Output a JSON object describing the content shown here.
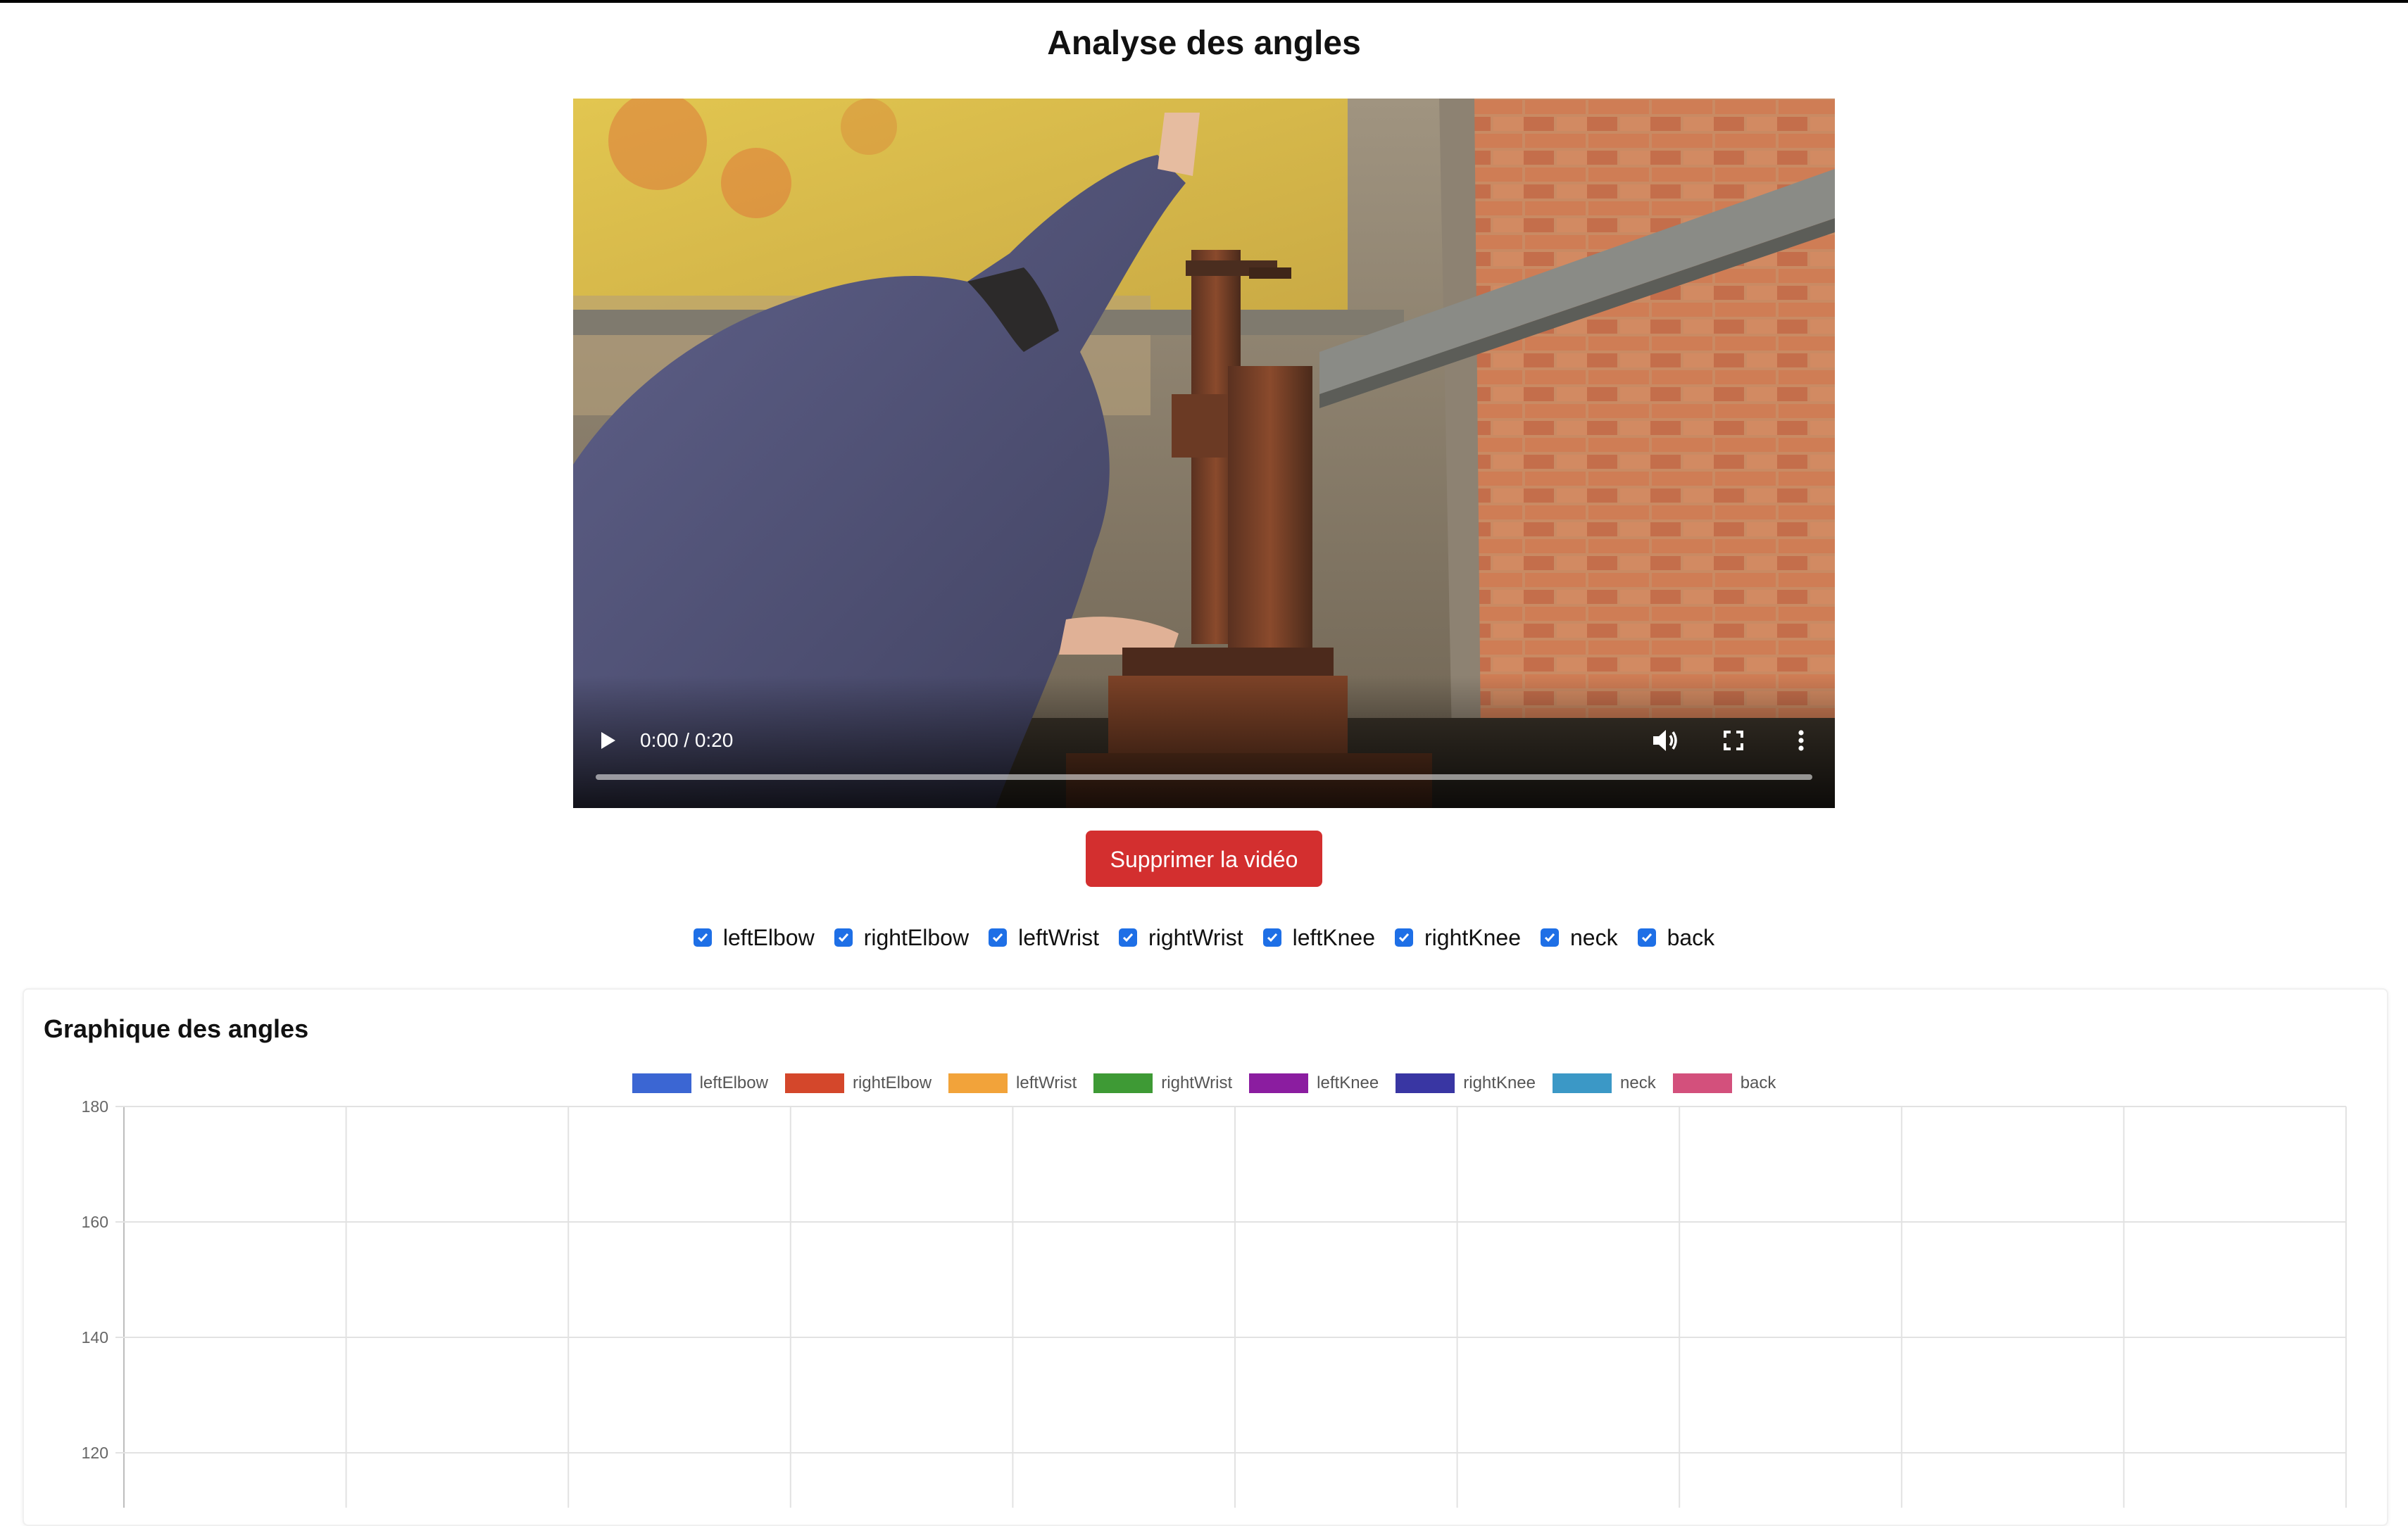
{
  "page": {
    "title": "Analyse des angles"
  },
  "video": {
    "time_display": "0:00 / 0:20",
    "progress": 0.0,
    "icons": {
      "play": "play-icon",
      "volume": "volume-icon",
      "fullscreen": "fullscreen-icon",
      "more": "more-options-icon"
    }
  },
  "actions": {
    "delete_label": "Supprimer la vidéo"
  },
  "toggles": [
    {
      "label": "leftElbow",
      "checked": true
    },
    {
      "label": "rightElbow",
      "checked": true
    },
    {
      "label": "leftWrist",
      "checked": true
    },
    {
      "label": "rightWrist",
      "checked": true
    },
    {
      "label": "leftKnee",
      "checked": true
    },
    {
      "label": "rightKnee",
      "checked": true
    },
    {
      "label": "neck",
      "checked": true
    },
    {
      "label": "back",
      "checked": true
    }
  ],
  "chart_section": {
    "title": "Graphique des angles"
  },
  "chart_data": {
    "type": "line",
    "ylim": [
      120,
      180
    ],
    "yticks": [
      180,
      160,
      140,
      120
    ],
    "x_gridlines": 10,
    "grid": true,
    "legend_placement": "top",
    "series": [
      {
        "name": "leftElbow",
        "color": "#3b66d3",
        "values": []
      },
      {
        "name": "rightElbow",
        "color": "#d4472b",
        "values": []
      },
      {
        "name": "leftWrist",
        "color": "#f2a33a",
        "values": []
      },
      {
        "name": "rightWrist",
        "color": "#3e9a35",
        "values": []
      },
      {
        "name": "leftKnee",
        "color": "#8b1da0",
        "values": []
      },
      {
        "name": "rightKnee",
        "color": "#3936a3",
        "values": []
      },
      {
        "name": "neck",
        "color": "#3b98c6",
        "values": []
      },
      {
        "name": "back",
        "color": "#d3507c",
        "values": []
      }
    ]
  }
}
